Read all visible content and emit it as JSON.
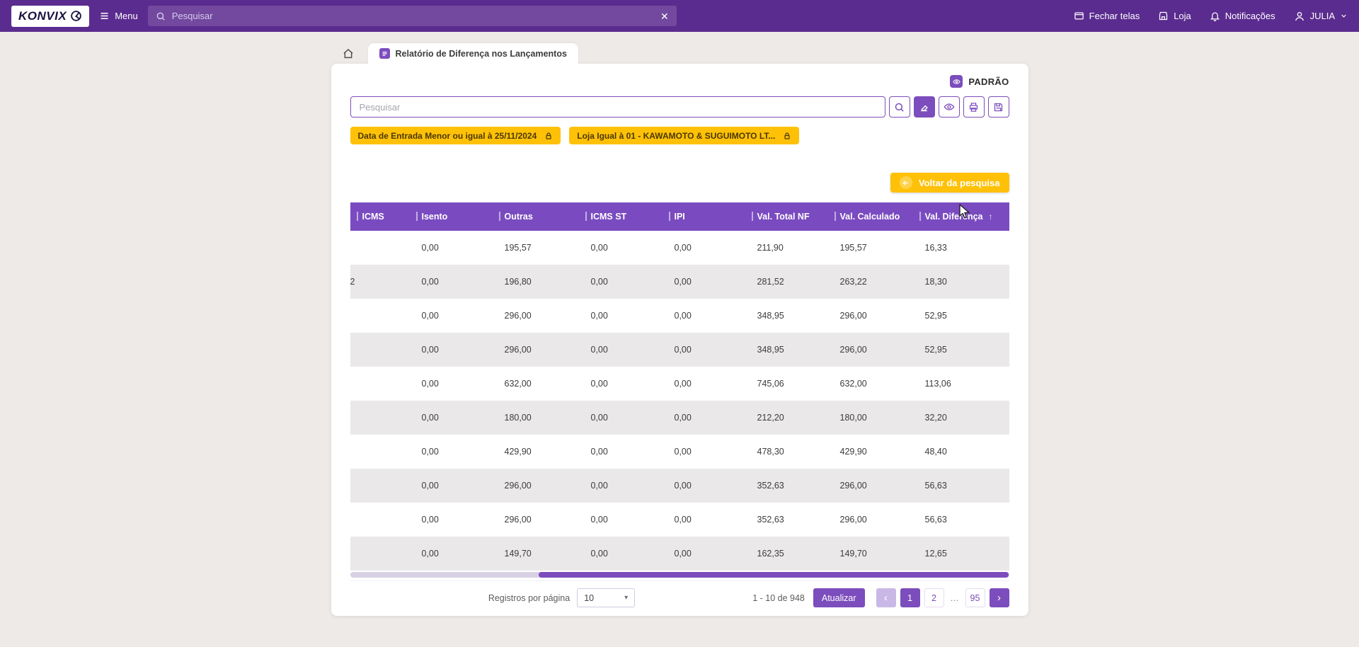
{
  "topbar": {
    "logo": "KONVIX",
    "menu_label": "Menu",
    "search_placeholder": "Pesquisar",
    "search_value": "",
    "actions": {
      "fechar_telas": "Fechar telas",
      "loja": "Loja",
      "notificacoes": "Notificações",
      "user": "JULIA"
    }
  },
  "tabbar": {
    "active_tab": "Relatório de Diferença nos Lançamentos"
  },
  "panel": {
    "padrao_label": "PADRÃO",
    "search_placeholder": "Pesquisar",
    "search_value": "",
    "filters": [
      {
        "label": "Data de Entrada Menor ou igual à 25/11/2024",
        "locked": true
      },
      {
        "label": "Loja Igual à 01 - KAWAMOTO & SUGUIMOTO LT...",
        "locked": true
      }
    ],
    "back_button_label": "Voltar da pesquisa"
  },
  "table": {
    "columns": [
      "ICMS",
      "Isento",
      "Outras",
      "ICMS ST",
      "IPI",
      "Val. Total NF",
      "Val. Calculado",
      "Val. Diferença"
    ],
    "sort": {
      "column": "Val. Diferença",
      "direction": "asc",
      "indicator": "↑"
    },
    "clipped_fragment": "2",
    "clipped_row_index": 1,
    "rows": [
      [
        "",
        "0,00",
        "195,57",
        "0,00",
        "0,00",
        "211,90",
        "195,57",
        "16,33"
      ],
      [
        "",
        "0,00",
        "196,80",
        "0,00",
        "0,00",
        "281,52",
        "263,22",
        "18,30"
      ],
      [
        "",
        "0,00",
        "296,00",
        "0,00",
        "0,00",
        "348,95",
        "296,00",
        "52,95"
      ],
      [
        "",
        "0,00",
        "296,00",
        "0,00",
        "0,00",
        "348,95",
        "296,00",
        "52,95"
      ],
      [
        "",
        "0,00",
        "632,00",
        "0,00",
        "0,00",
        "745,06",
        "632,00",
        "113,06"
      ],
      [
        "",
        "0,00",
        "180,00",
        "0,00",
        "0,00",
        "212,20",
        "180,00",
        "32,20"
      ],
      [
        "",
        "0,00",
        "429,90",
        "0,00",
        "0,00",
        "478,30",
        "429,90",
        "48,40"
      ],
      [
        "",
        "0,00",
        "296,00",
        "0,00",
        "0,00",
        "352,63",
        "296,00",
        "56,63"
      ],
      [
        "",
        "0,00",
        "296,00",
        "0,00",
        "0,00",
        "352,63",
        "296,00",
        "56,63"
      ],
      [
        "",
        "0,00",
        "149,70",
        "0,00",
        "0,00",
        "162,35",
        "149,70",
        "12,65"
      ]
    ]
  },
  "footer": {
    "registros_label": "Registros por página",
    "page_size": "10",
    "range_label": "1 - 10 de 948",
    "refresh_label": "Atualizar",
    "pages": [
      "1",
      "2",
      "...",
      "95"
    ],
    "active_page": "1"
  },
  "colors": {
    "topbar": "#5b2c8f",
    "accent": "#7c4dbc",
    "warning": "#ffc107",
    "row_alt": "#eae8e8",
    "page_bg": "#edeae8"
  }
}
